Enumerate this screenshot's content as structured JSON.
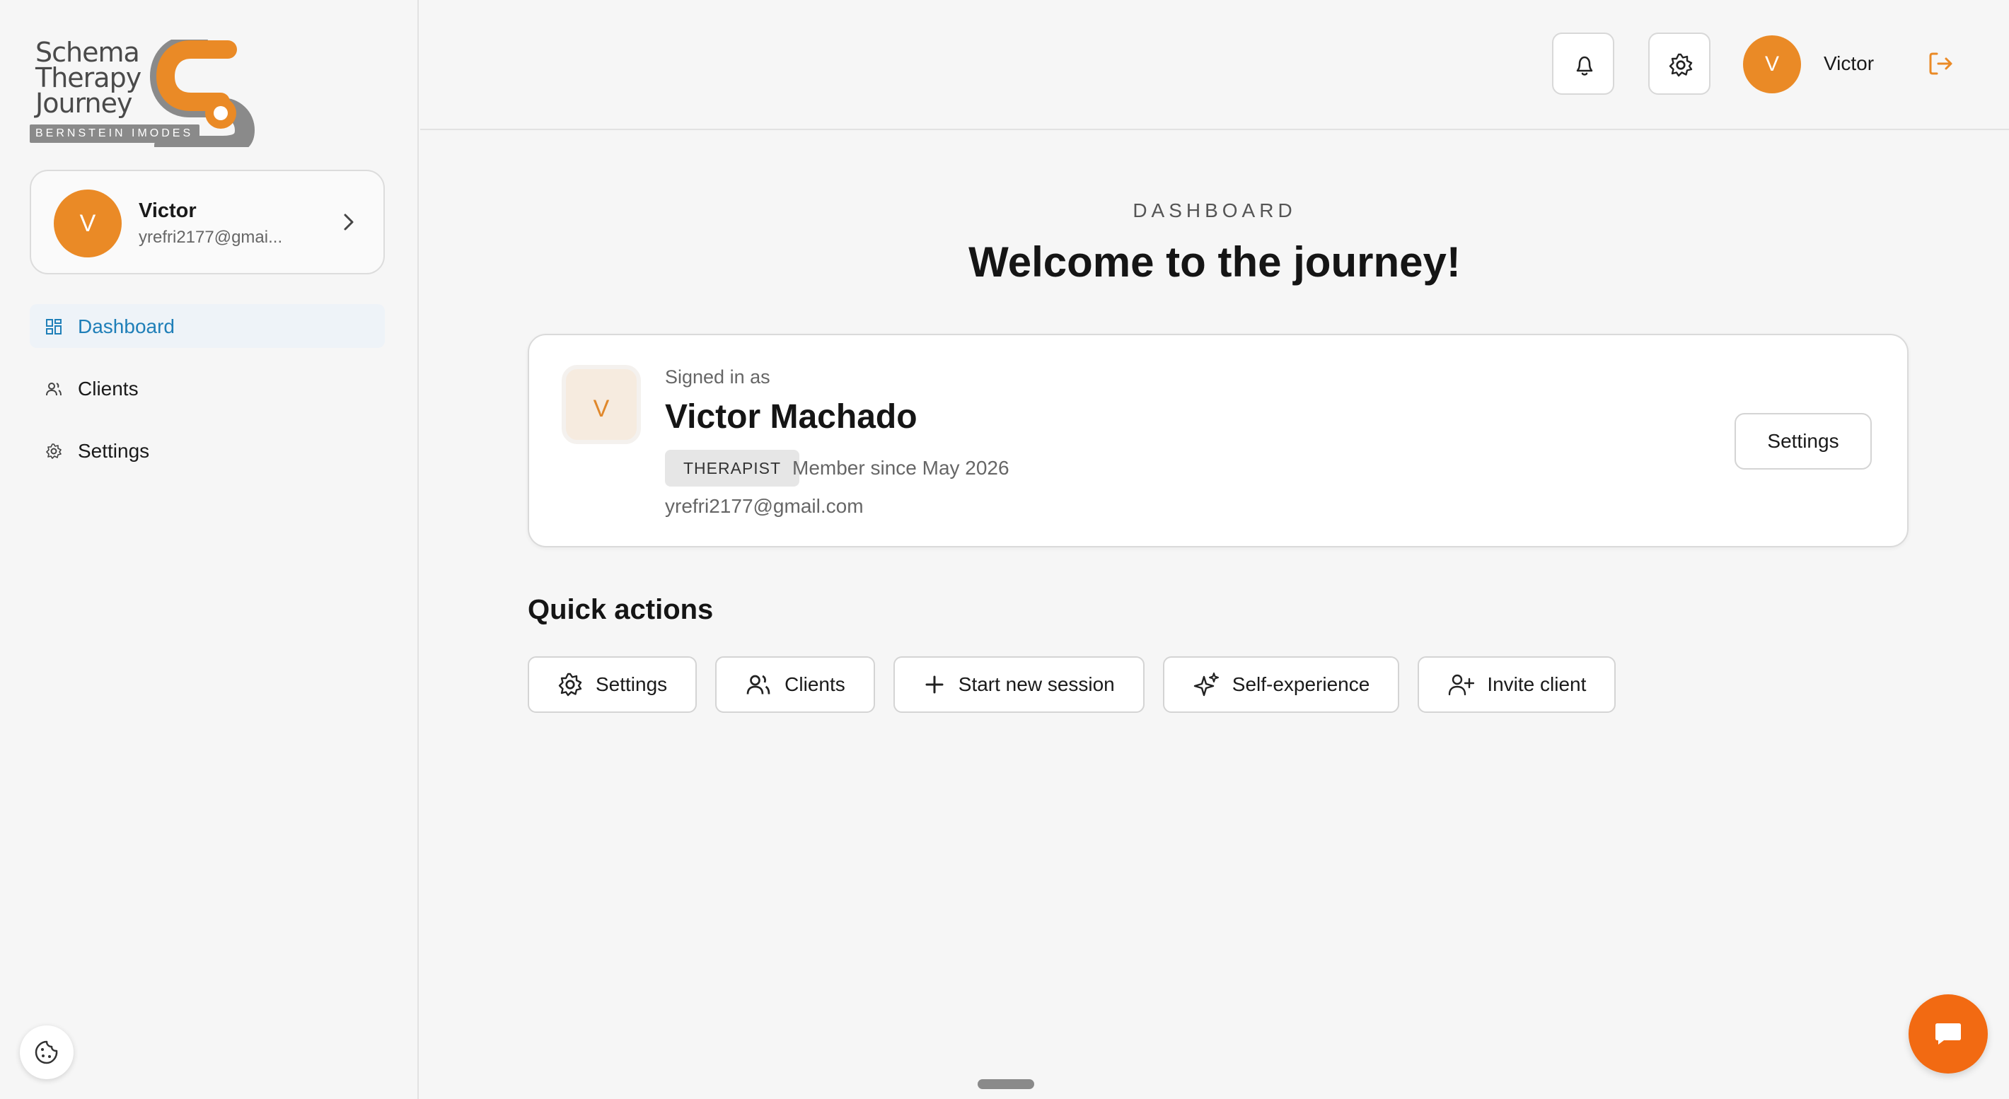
{
  "logo": {
    "title_line1": "Schema",
    "title_line2": "Therapy",
    "title_line3": "Journey",
    "subtitle": "BERNSTEIN IMODES",
    "brand_color": "#ea8a26"
  },
  "sidebar": {
    "profile": {
      "initial": "V",
      "name": "Victor",
      "email": "yrefri2177@gmai..."
    },
    "items": [
      {
        "label": "Dashboard",
        "icon": "dashboard-grid-icon",
        "active": true
      },
      {
        "label": "Clients",
        "icon": "users-icon",
        "active": false
      },
      {
        "label": "Settings",
        "icon": "gear-icon",
        "active": false
      }
    ]
  },
  "header": {
    "avatar_initial": "V",
    "user_name": "Victor"
  },
  "main": {
    "eyebrow": "DASHBOARD",
    "headline": "Welcome to the journey!",
    "user_card": {
      "avatar_initial": "V",
      "signed_label": "Signed in as",
      "full_name": "Victor Machado",
      "role": "THERAPIST",
      "member_since": "Member since May 2026",
      "email": "yrefri2177@gmail.com",
      "settings_label": "Settings"
    },
    "quick_actions": {
      "title": "Quick actions",
      "buttons": [
        {
          "label": "Settings",
          "icon": "gear-icon"
        },
        {
          "label": "Clients",
          "icon": "users-icon"
        },
        {
          "label": "Start new session",
          "icon": "plus-icon"
        },
        {
          "label": "Self-experience",
          "icon": "sparkles-icon"
        },
        {
          "label": "Invite client",
          "icon": "user-plus-icon"
        }
      ]
    }
  },
  "colors": {
    "accent_orange": "#ea8a26",
    "chat_orange": "#f26a12",
    "active_nav_blue": "#1f7fb8"
  }
}
